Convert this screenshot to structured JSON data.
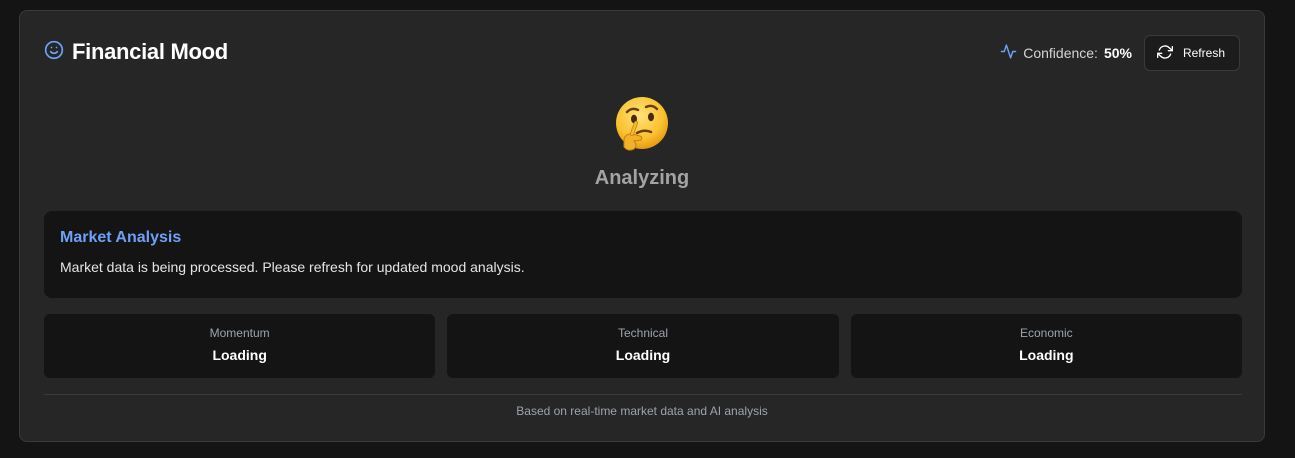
{
  "header": {
    "title": "Financial Mood",
    "title_icon": "smile-icon",
    "confidence_label": "Confidence:",
    "confidence_value": "50%",
    "confidence_icon": "activity-icon",
    "refresh_label": "Refresh",
    "refresh_icon": "refresh-icon"
  },
  "mood": {
    "emoji": "thinking-face",
    "label": "Analyzing"
  },
  "analysis": {
    "title": "Market Analysis",
    "text": "Market data is being processed. Please refresh for updated mood analysis."
  },
  "metrics": [
    {
      "label": "Momentum",
      "value": "Loading"
    },
    {
      "label": "Technical",
      "value": "Loading"
    },
    {
      "label": "Economic",
      "value": "Loading"
    }
  ],
  "footer": {
    "text": "Based on real-time market data and AI analysis"
  },
  "colors": {
    "accent": "#6ea1f5",
    "background": "#141414",
    "card": "#262626"
  }
}
